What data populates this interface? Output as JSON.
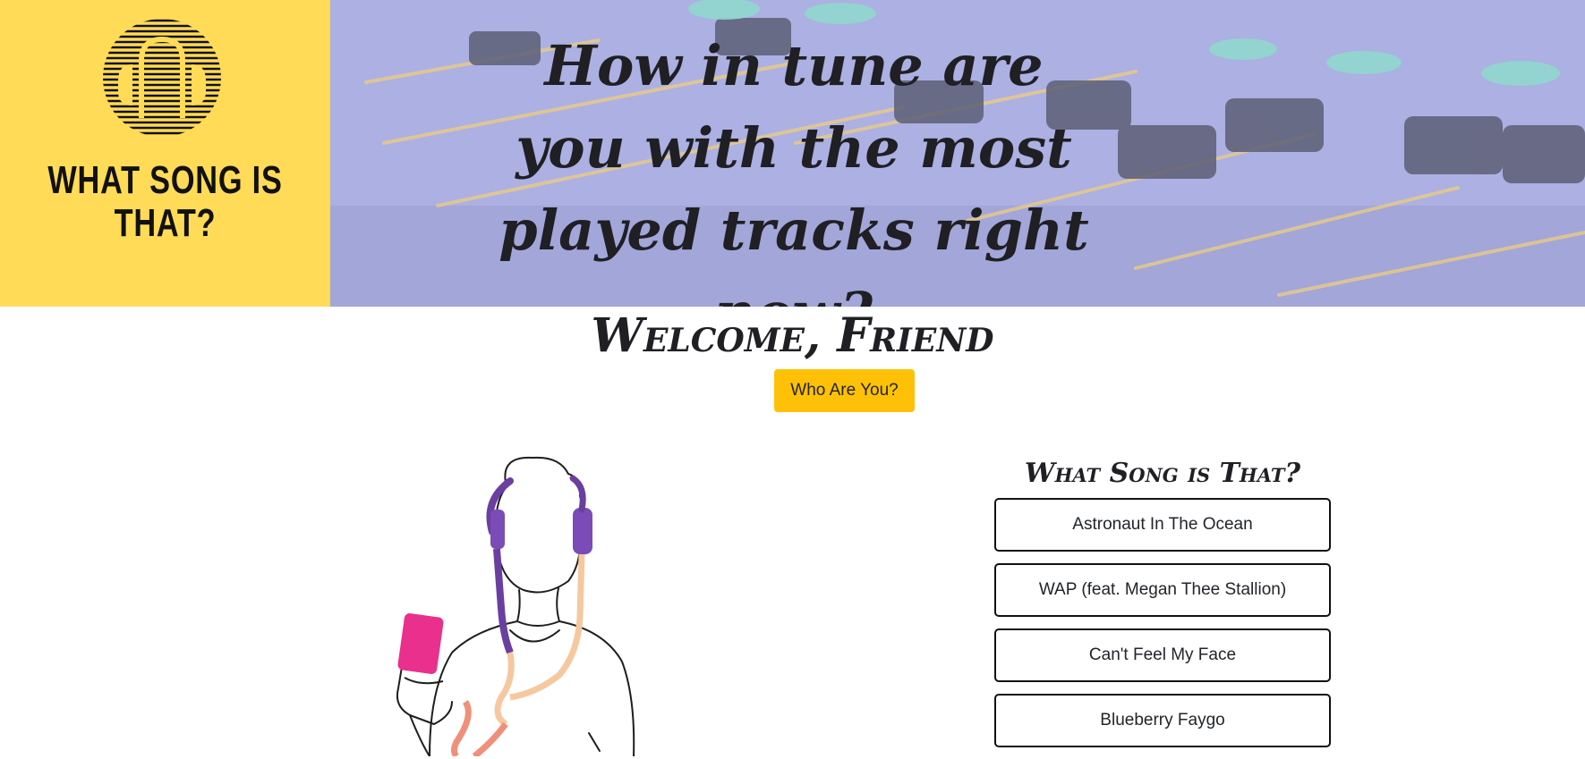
{
  "brand": {
    "title": "WHAT SONG IS THAT?",
    "icon": "headphones-logo-icon",
    "background_color": "#ffdb58"
  },
  "hero": {
    "headline": "How in tune are you with the most played tracks right now?",
    "background": "mixing-console-image"
  },
  "welcome": {
    "heading": "Welcome, Friend",
    "button_label": "Who Are You?",
    "button_color": "#ffc107"
  },
  "illustration": {
    "name": "person-with-headphones-illustration"
  },
  "quiz": {
    "title": "What Song is That?",
    "options": [
      "Astronaut In The Ocean",
      "WAP (feat. Megan Thee Stallion)",
      "Can't Feel My Face",
      "Blueberry Faygo"
    ]
  }
}
